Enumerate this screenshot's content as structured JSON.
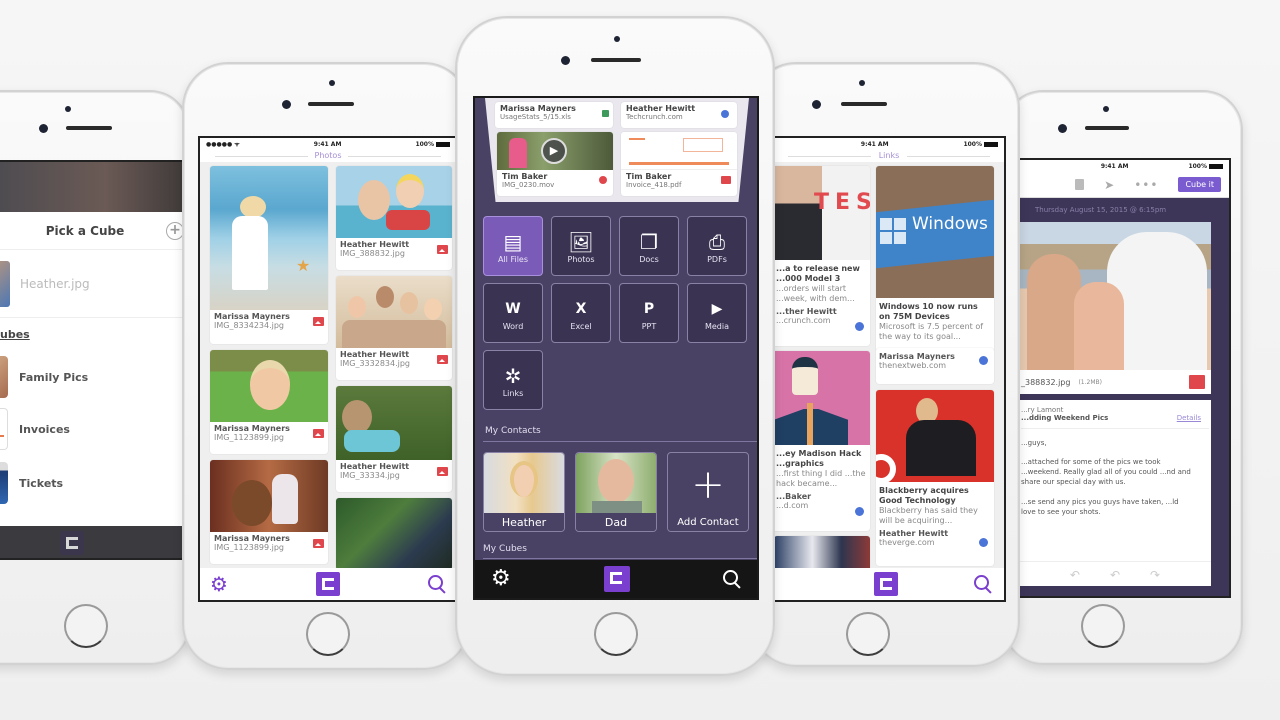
{
  "status_bar": {
    "time": "9:41 AM",
    "battery": "100%",
    "signal": "●●●●● ᯤ"
  },
  "phone_left": {
    "header_title": "Pick a Cube",
    "add_icon": "plus-circle-icon",
    "selected_file": "Heather.jpg",
    "section_label": "My Cubes",
    "cubes": [
      {
        "label": "Family Pics"
      },
      {
        "label": "Invoices"
      },
      {
        "label": "Tickets"
      }
    ]
  },
  "phone_photos": {
    "section_title": "Photos",
    "items": [
      {
        "name": "Marissa Mayners",
        "file": "IMG_8334234.jpg"
      },
      {
        "name": "Heather Hewitt",
        "file": "IMG_388832.jpg"
      },
      {
        "name": "Heather Hewitt",
        "file": "IMG_3332834.jpg"
      },
      {
        "name": "Marissa Mayners",
        "file": "IMG_1123899.jpg"
      },
      {
        "name": "Heather Hewitt",
        "file": "IMG_33334.jpg"
      },
      {
        "name": "Marissa Mayners",
        "file": "IMG_1123899.jpg"
      }
    ],
    "tabbar": {
      "settings_icon": "gear-icon",
      "home_icon": "cube-logo-icon",
      "search_icon": "search-icon"
    }
  },
  "phone_center": {
    "recent": [
      {
        "name": "Marissa Mayners",
        "file": "UsageStats_5/15.xls",
        "type": "xls"
      },
      {
        "name": "Heather Hewitt",
        "file": "Techcrunch.com",
        "type": "link"
      },
      {
        "name": "Tim Baker",
        "file": "IMG_0230.mov",
        "type": "video"
      },
      {
        "name": "Tim Baker",
        "file": "Invoice_418.pdf",
        "type": "pdf"
      }
    ],
    "categories": [
      {
        "label": "All Files",
        "icon": "inbox-tray-icon",
        "active": true
      },
      {
        "label": "Photos",
        "icon": "photo-icon",
        "active": false
      },
      {
        "label": "Docs",
        "icon": "docs-icon",
        "active": false
      },
      {
        "label": "PDFs",
        "icon": "pdf-icon",
        "active": false
      },
      {
        "label": "Word",
        "icon": "word-icon",
        "active": false
      },
      {
        "label": "Excel",
        "icon": "excel-icon",
        "active": false
      },
      {
        "label": "PPT",
        "icon": "ppt-icon",
        "active": false
      },
      {
        "label": "Media",
        "icon": "media-icon",
        "active": false
      },
      {
        "label": "Links",
        "icon": "links-icon",
        "active": false
      }
    ],
    "contacts_label": "My Contacts",
    "contacts": [
      {
        "label": "Heather"
      },
      {
        "label": "Dad"
      }
    ],
    "add_contact_label": "Add Contact",
    "cubes_label": "My Cubes"
  },
  "phone_links": {
    "section_title": "Links",
    "items": [
      {
        "title": "...a to release new ...000 Model 3",
        "desc": "...orders will start ...week, with dem...",
        "name": "...ther Hewitt",
        "source": "...crunch.com"
      },
      {
        "title": "Windows 10 now runs on 75M Devices",
        "desc": "Microsoft is 7.5 percent of the way to its goal...",
        "name": "Marissa Mayners",
        "source": "thenextweb.com"
      },
      {
        "title": "...ey Madison Hack ...graphics",
        "desc": "...first thing I did ...the hack became...",
        "name": "...Baker",
        "source": "...d.com"
      },
      {
        "title": "Blackberry acquires Good Technology",
        "desc": "Blackberry has said they will be acquiring...",
        "name": "Heather Hewitt",
        "source": "theverge.com"
      }
    ],
    "windows_text": "Windows",
    "tesla_text": "TES"
  },
  "phone_email": {
    "cube_it_label": "Cube it",
    "date": "Thursday August 15, 2015 @ 6:15pm",
    "attachment_file": "_388832.jpg",
    "attachment_size": "(1.2MB)",
    "from": "...ry Lamont",
    "subject": "...dding Weekend Pics",
    "details_link": "Details",
    "body": [
      "...guys,",
      "...attached for some of the pics we took ...weekend. Really glad all of you could ...nd and share our special day with us.",
      "...se send any pics you guys have taken, ...ld love to see your shots."
    ],
    "accent": "#7b5bd0"
  },
  "colors": {
    "brand_purple": "#7a3fcf",
    "dark_bg": "#4a4264",
    "tab_black": "#151515",
    "badge_red": "#e0474c"
  }
}
